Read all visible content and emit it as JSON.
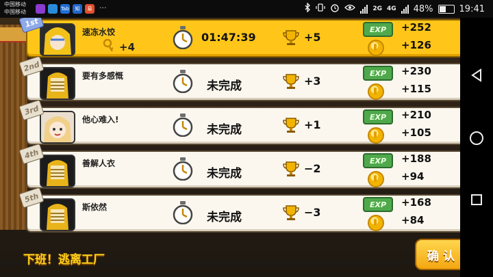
{
  "status_bar": {
    "carrier_1": "中国移动",
    "carrier_2": "中国移动",
    "net_1": "2G",
    "net_2": "4G",
    "battery": "48%",
    "time": "19:41",
    "more": "···",
    "notification_icons": [
      {
        "name": "app-icon-1",
        "color": "#8c3bd0",
        "label": ""
      },
      {
        "name": "app-icon-2",
        "color": "#2a8ad8",
        "label": ""
      },
      {
        "name": "app-icon-3",
        "color": "#1f6fd6",
        "label": "Tab"
      },
      {
        "name": "app-icon-4",
        "color": "#2466c8",
        "label": "知"
      },
      {
        "name": "app-icon-5",
        "color": "#e2502d",
        "label": "易"
      }
    ]
  },
  "results": [
    {
      "rank": "1st",
      "name": "速冻水饺",
      "keys": "+4",
      "time": "01:47:39",
      "trophy": "+5",
      "exp": "+252",
      "coins": "+126",
      "highlight": true
    },
    {
      "rank": "2nd",
      "name": "要有多感慨",
      "status": "未完成",
      "trophy": "+3",
      "exp": "+230",
      "coins": "+115"
    },
    {
      "rank": "3rd",
      "name": "他心难入!",
      "status": "未完成",
      "trophy": "+1",
      "exp": "+210",
      "coins": "+105"
    },
    {
      "rank": "4th",
      "name": "善解人衣",
      "status": "未完成",
      "trophy": "−2",
      "exp": "+188",
      "coins": "+94"
    },
    {
      "rank": "5th",
      "name": "斯依然",
      "status": "未完成",
      "trophy": "−3",
      "exp": "+168",
      "coins": "+84"
    }
  ],
  "exp_label": "EXP",
  "footer": {
    "level_title": "下班！逃离工厂",
    "confirm_label": "确认"
  },
  "colors": {
    "first_row": "#ffc619",
    "row": "#fbf7ee",
    "title": "#ffd21c"
  }
}
